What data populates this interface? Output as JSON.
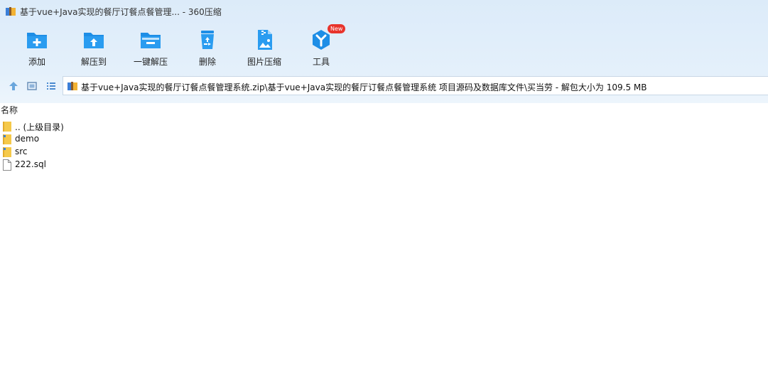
{
  "window": {
    "title": "基于vue+Java实现的餐厅订餐点餐管理... - 360压缩",
    "app_icon": "archive-icon"
  },
  "toolbar": {
    "items": [
      {
        "label": "添加",
        "icon": "add-folder-icon"
      },
      {
        "label": "解压到",
        "icon": "extract-to-icon"
      },
      {
        "label": "一键解压",
        "icon": "one-click-extract-icon"
      },
      {
        "label": "删除",
        "icon": "recycle-bin-icon"
      },
      {
        "label": "图片压缩",
        "icon": "image-compress-icon"
      },
      {
        "label": "工具",
        "icon": "tools-icon",
        "badge": "New"
      }
    ]
  },
  "nav": {
    "path": "基于vue+Java实现的餐厅订餐点餐管理系统.zip\\基于vue+Java实现的餐厅订餐点餐管理系统 项目源码及数据库文件\\买当劳 - 解包大小为 109.5 MB"
  },
  "list": {
    "column_header": "名称",
    "rows": [
      {
        "name": ".. (上级目录)",
        "type": "folder"
      },
      {
        "name": "demo",
        "type": "folder"
      },
      {
        "name": "src",
        "type": "folder"
      },
      {
        "name": "222.sql",
        "type": "file"
      }
    ]
  },
  "colors": {
    "accent": "#1e8ee6",
    "toolbar_bg": "#dcebf9",
    "badge": "#e8342c",
    "folder": "#f5c94a"
  }
}
